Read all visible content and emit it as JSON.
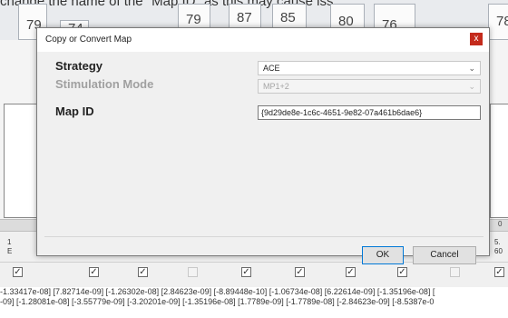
{
  "background": {
    "top_text": "change the name of the \"Map ID\" as this may cause iss",
    "top_numbers": [
      "79",
      "74",
      "79",
      "87",
      "85",
      "80",
      "76",
      "78"
    ],
    "ruler_labels": [
      "0"
    ],
    "left_tiny_text": [
      "1",
      "E"
    ],
    "right_tiny_text": [
      "5.",
      "60"
    ],
    "checkboxes": [
      {
        "checked": true
      },
      {
        "checked": true
      },
      {
        "checked": true
      },
      {
        "checked": false,
        "disabled": true
      },
      {
        "checked": true
      },
      {
        "checked": true
      },
      {
        "checked": true
      },
      {
        "checked": true
      },
      {
        "checked": false,
        "disabled": true
      },
      {
        "checked": true
      }
    ],
    "data_lines": [
      "-1.33417e-08] [7.82714e-09] [-1.26302e-08] [2.84623e-09] [-8.89448e-10] [-1.06734e-08] [6.22614e-09] [-1.35196e-08] [",
      "-09] [-1.28081e-08] [-3.55779e-09] [-3.20201e-09] [-1.35196e-08] [1.7789e-09] [-1.7789e-08] [-2.84623e-09] [-8.5387e-0"
    ]
  },
  "dialog": {
    "title": "Copy or Convert Map",
    "close_label": "x",
    "fields": {
      "strategy_label": "Strategy",
      "strategy_value": "ACE",
      "stimulation_label": "Stimulation Mode",
      "stimulation_value": "MP1+2",
      "map_id_label": "Map ID",
      "map_id_value": "{9d29de8e-1c6c-4651-9e82-07a461b6dae6}"
    },
    "ok_label": "OK",
    "cancel_label": "Cancel"
  },
  "colors": {
    "close_button": "#c42b1c",
    "primary_button_border": "#0078d7"
  }
}
